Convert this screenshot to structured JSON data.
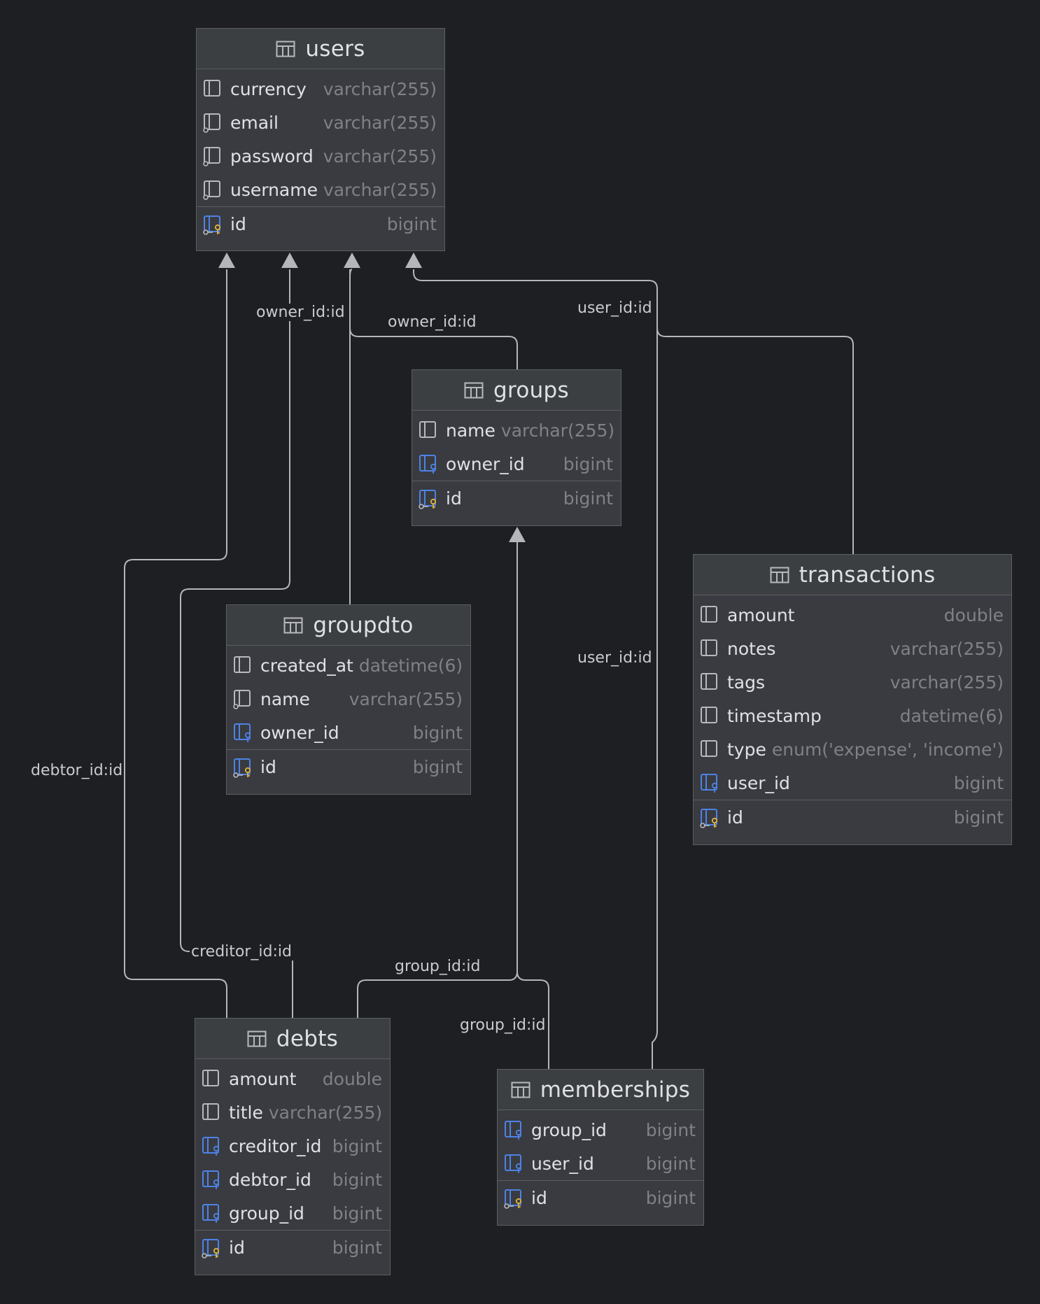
{
  "tables": {
    "users": {
      "title": "users",
      "rows": [
        {
          "name": "currency",
          "type": "varchar(255)",
          "icon": "column"
        },
        {
          "name": "email",
          "type": "varchar(255)",
          "icon": "unique"
        },
        {
          "name": "password",
          "type": "varchar(255)",
          "icon": "unique"
        },
        {
          "name": "username",
          "type": "varchar(255)",
          "icon": "unique"
        },
        {
          "name": "id",
          "type": "bigint",
          "icon": "pk"
        }
      ]
    },
    "groups": {
      "title": "groups",
      "rows": [
        {
          "name": "name",
          "type": "varchar(255)",
          "icon": "column"
        },
        {
          "name": "owner_id",
          "type": "bigint",
          "icon": "fk"
        },
        {
          "name": "id",
          "type": "bigint",
          "icon": "pk"
        }
      ]
    },
    "transactions": {
      "title": "transactions",
      "rows": [
        {
          "name": "amount",
          "type": "double",
          "icon": "column"
        },
        {
          "name": "notes",
          "type": "varchar(255)",
          "icon": "column"
        },
        {
          "name": "tags",
          "type": "varchar(255)",
          "icon": "column"
        },
        {
          "name": "timestamp",
          "type": "datetime(6)",
          "icon": "column"
        },
        {
          "name": "type",
          "type": "enum('expense', 'income')",
          "icon": "column"
        },
        {
          "name": "user_id",
          "type": "bigint",
          "icon": "fk"
        },
        {
          "name": "id",
          "type": "bigint",
          "icon": "pk"
        }
      ]
    },
    "groupdto": {
      "title": "groupdto",
      "rows": [
        {
          "name": "created_at",
          "type": "datetime(6)",
          "icon": "column"
        },
        {
          "name": "name",
          "type": "varchar(255)",
          "icon": "unique"
        },
        {
          "name": "owner_id",
          "type": "bigint",
          "icon": "fk"
        },
        {
          "name": "id",
          "type": "bigint",
          "icon": "pk"
        }
      ]
    },
    "debts": {
      "title": "debts",
      "rows": [
        {
          "name": "amount",
          "type": "double",
          "icon": "column"
        },
        {
          "name": "title",
          "type": "varchar(255)",
          "icon": "column"
        },
        {
          "name": "creditor_id",
          "type": "bigint",
          "icon": "fk"
        },
        {
          "name": "debtor_id",
          "type": "bigint",
          "icon": "fk"
        },
        {
          "name": "group_id",
          "type": "bigint",
          "icon": "fk"
        },
        {
          "name": "id",
          "type": "bigint",
          "icon": "pk"
        }
      ]
    },
    "memberships": {
      "title": "memberships",
      "rows": [
        {
          "name": "group_id",
          "type": "bigint",
          "icon": "fk"
        },
        {
          "name": "user_id",
          "type": "bigint",
          "icon": "fk"
        },
        {
          "name": "id",
          "type": "bigint",
          "icon": "pk"
        }
      ]
    }
  },
  "edges": {
    "groupdto_owner": "owner_id:id",
    "groups_owner": "owner_id:id",
    "transactions_user": "user_id:id",
    "memberships_user": "user_id:id",
    "debts_debtor": "debtor_id:id",
    "debts_creditor": "creditor_id:id",
    "debts_group": "group_id:id",
    "memberships_group": "group_id:id"
  },
  "colors": {
    "background": "#1e1f22",
    "table_fill": "#393b40",
    "border": "#5b5e63",
    "line": "#b4b6ba",
    "fk_icon": "#4e82e6",
    "pk_key": "#e0b33c"
  }
}
